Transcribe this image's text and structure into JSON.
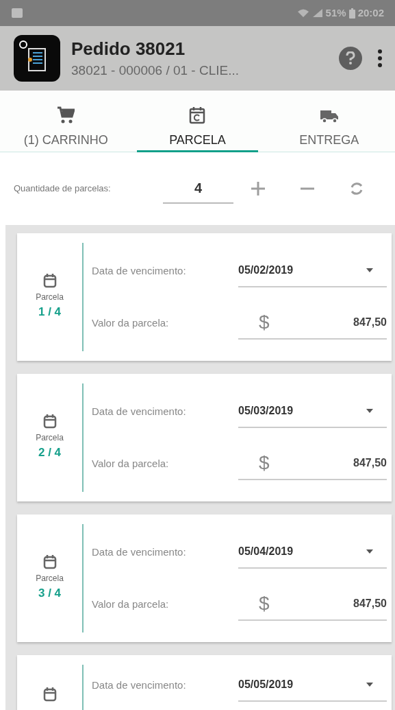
{
  "status_bar": {
    "battery": "51%",
    "time": "20:02"
  },
  "header": {
    "title": "Pedido 38021",
    "subtitle": "38021 - 000006 / 01 - CLIE..."
  },
  "tabs": [
    {
      "kind": "cart",
      "label": "(1) CARRINHO",
      "selected": false
    },
    {
      "kind": "calendar",
      "label": "PARCELA",
      "selected": true
    },
    {
      "kind": "truck",
      "label": "ENTREGA",
      "selected": false
    }
  ],
  "quantity": {
    "label": "Quantidade de parcelas:",
    "value": "4"
  },
  "installments": [
    {
      "caption": "Parcela",
      "number": "1 / 4",
      "date_label": "Data de vencimento:",
      "date": "05/02/2019",
      "value_label": "Valor da parcela:",
      "currency": "$",
      "value": "847,50"
    },
    {
      "caption": "Parcela",
      "number": "2 / 4",
      "date_label": "Data de vencimento:",
      "date": "05/03/2019",
      "value_label": "Valor da parcela:",
      "currency": "$",
      "value": "847,50"
    },
    {
      "caption": "Parcela",
      "number": "3 / 4",
      "date_label": "Data de vencimento:",
      "date": "05/04/2019",
      "value_label": "Valor da parcela:",
      "currency": "$",
      "value": "847,50"
    },
    {
      "date_label": "Data de vencimento:",
      "date": "05/05/2019"
    }
  ]
}
